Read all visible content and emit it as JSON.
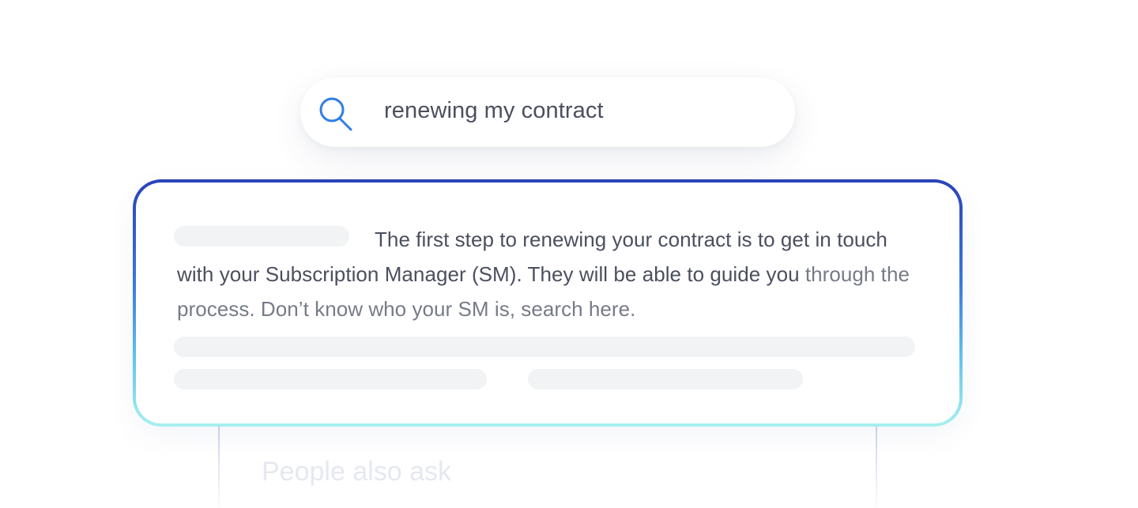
{
  "search": {
    "query": "renewing my contract",
    "icon": "search-icon",
    "icon_color": "#2f7ee6"
  },
  "answer": {
    "text_main": "The first step to renewing your contract is to get in touch with your Subscription Manager (SM). They will be able to guide you ",
    "text_faded": "through the process. Don’t know who your SM is, search here.",
    "border_colors": [
      "#2a42b8",
      "#3a78de",
      "#5fc3ef",
      "#a8f0ee"
    ]
  },
  "related": {
    "heading": "People also  ask"
  }
}
